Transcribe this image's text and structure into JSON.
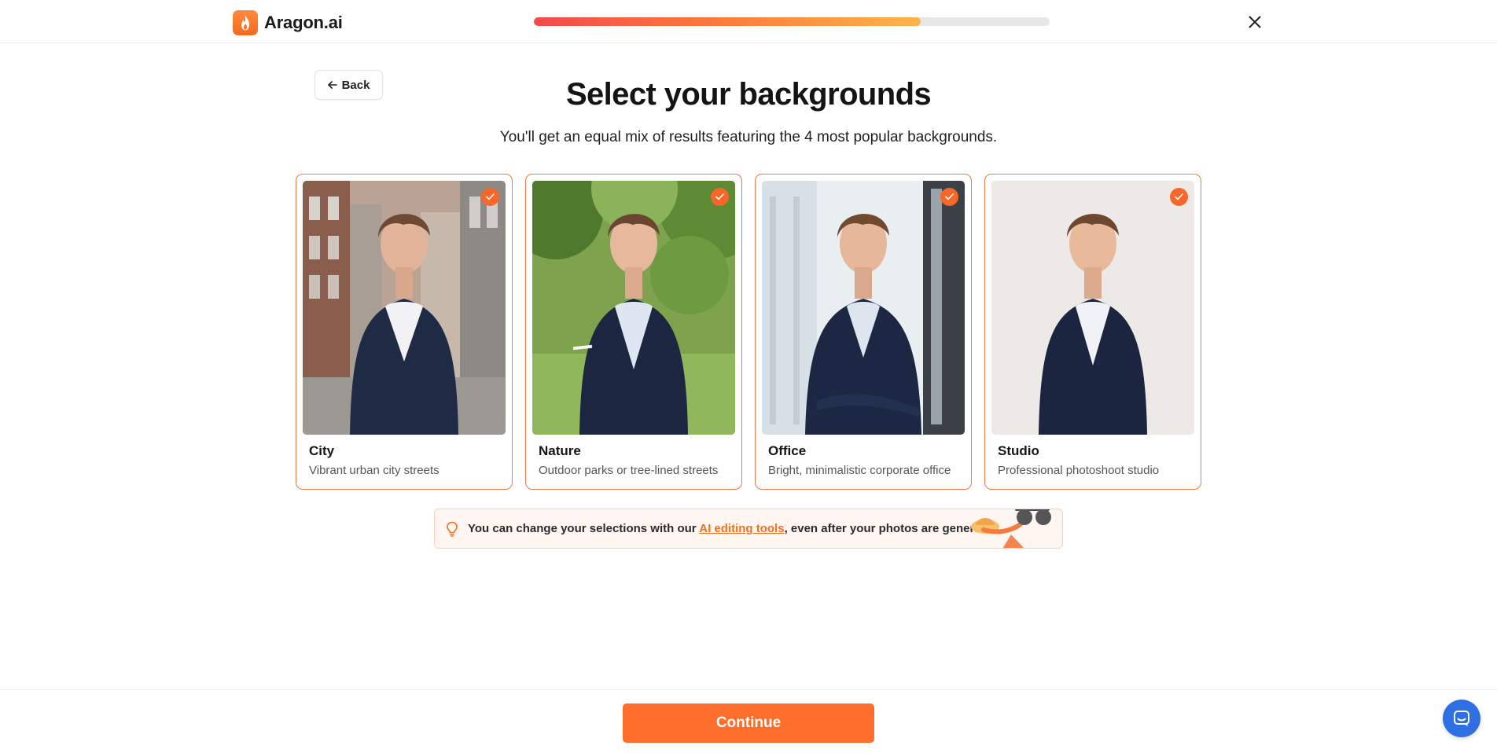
{
  "header": {
    "brand": "Aragon.ai",
    "progress_percent": 75
  },
  "back_label": "Back",
  "title": "Select your backgrounds",
  "subtitle": "You'll get an equal mix of results featuring the 4 most popular backgrounds.",
  "cards": [
    {
      "name": "City",
      "description": "Vibrant urban city streets",
      "selected": true
    },
    {
      "name": "Nature",
      "description": "Outdoor parks or tree-lined streets",
      "selected": true
    },
    {
      "name": "Office",
      "description": "Bright, minimalistic corporate office",
      "selected": true
    },
    {
      "name": "Studio",
      "description": "Professional photoshoot studio",
      "selected": true
    }
  ],
  "tip": {
    "text_before": "You can change your selections with our ",
    "link_text": "AI editing tools",
    "text_after": ", even after your photos are generated."
  },
  "continue_label": "Continue",
  "colors": {
    "accent": "#fb6e2b",
    "card_border": "#f7774a",
    "chat_button": "#2f6fe4"
  }
}
